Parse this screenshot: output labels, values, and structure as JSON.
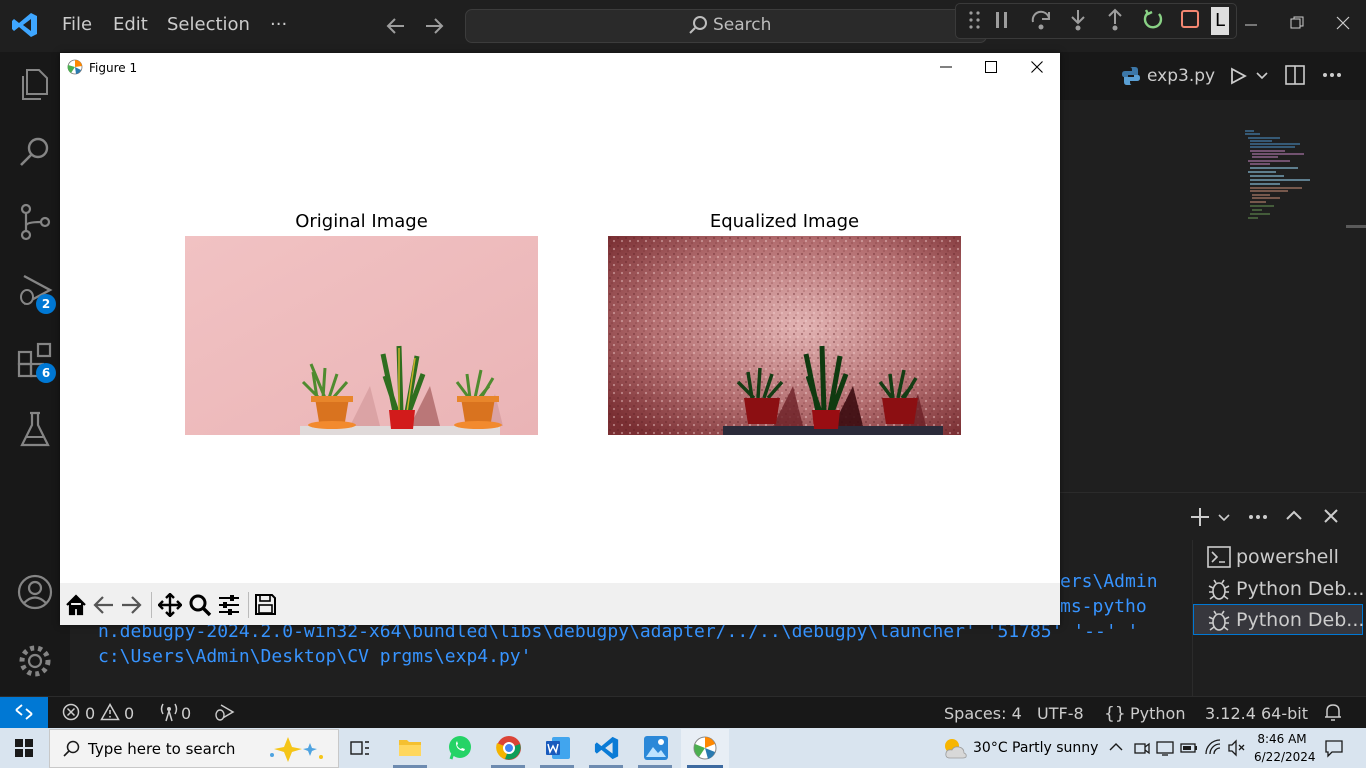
{
  "titlebar": {
    "menu": [
      "File",
      "Edit",
      "Selection",
      "···"
    ],
    "search_placeholder": "Search",
    "debug_letter": "L"
  },
  "activitybar": {
    "run_debug_badge": "2",
    "extensions_badge": "6"
  },
  "editor": {
    "tab_label": "exp3.py"
  },
  "figure": {
    "window_title": "Figure 1",
    "plots": [
      {
        "title": "Original Image"
      },
      {
        "title": "Equalized Image"
      }
    ]
  },
  "terminal": {
    "visible_fragments": [
      "ers\\Admin",
      "ms-pytho"
    ],
    "lines": [
      "n.debugpy-2024.2.0-win32-x64\\bundled\\libs\\debugpy\\adapter/../..\\debugpy\\launcher' '51785' '--' '",
      "c:\\Users\\Admin\\Desktop\\CV prgms\\exp4.py'"
    ],
    "list": [
      "powershell",
      "Python Deb...",
      "Python Deb..."
    ]
  },
  "statusbar": {
    "errors": "0",
    "warnings": "0",
    "ports": "0",
    "spaces": "Spaces: 4",
    "encoding": "UTF-8",
    "language": "Python",
    "interpreter": "3.12.4 64-bit"
  },
  "taskbar": {
    "search_placeholder": "Type here to search",
    "weather": "30°C",
    "weather_desc": "Partly sunny",
    "time": "8:46 AM",
    "date": "6/22/2024"
  },
  "colors": {
    "vscode_blue": "#0078d4",
    "terminal_text": "#3794ff",
    "original_bg": "#efbdbe",
    "equalized_bg": "#8a3a3c"
  }
}
